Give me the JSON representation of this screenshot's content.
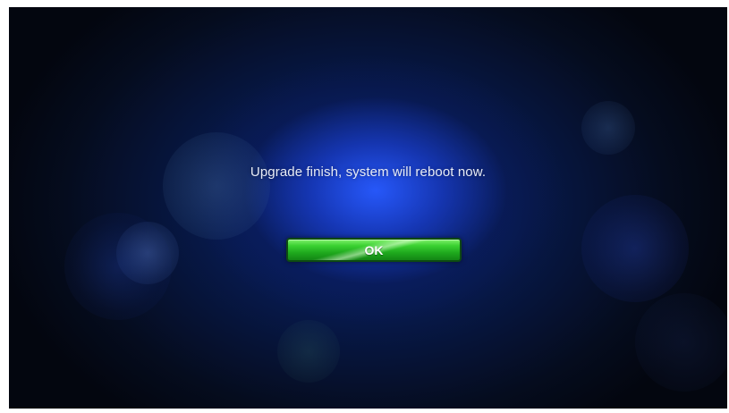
{
  "dialog": {
    "message": "Upgrade finish, system will reboot now.",
    "ok_label": "OK"
  },
  "colors": {
    "background_center": "#1f4dff",
    "background_edge": "#03060f",
    "button_green": "#2cc42a",
    "button_border": "#0e4a12",
    "text": "#e8ecf5"
  }
}
